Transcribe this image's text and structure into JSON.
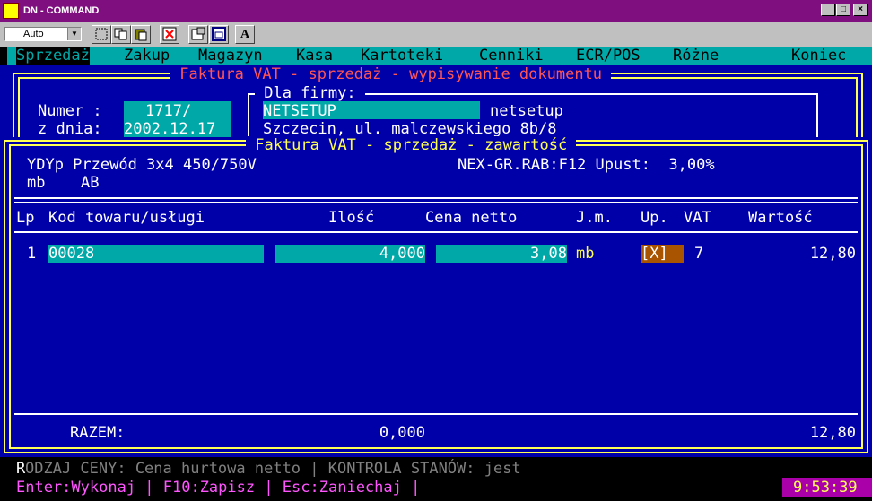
{
  "window": {
    "title": "DN - COMMAND",
    "minimize_glyph": "_",
    "maximize_glyph": "□",
    "close_glyph": "×"
  },
  "toolbar": {
    "font_size_value": "Auto",
    "font_glyph": "A"
  },
  "menu": {
    "items": [
      "Sprzedaż",
      "Zakup",
      "Magazyn",
      "Kasa",
      "Kartoteki",
      "Cenniki",
      "ECR/POS",
      "Różne",
      "Koniec"
    ]
  },
  "outer_panel": {
    "title": " Faktura VAT - sprzedaż - wypisywanie dokumentu ",
    "numer_label": "Numer :",
    "numer_value": "1717/",
    "date_label": "z dnia:",
    "date_value": "2002.12.17",
    "firm_label": " Dla firmy: ",
    "firm_code": "NETSETUP",
    "firm_name": "netsetup",
    "firm_address": "Szczecin, ul. malczewskiego 8b/8"
  },
  "inner_panel": {
    "title": " Faktura VAT - sprzedaż - zawartość ",
    "product_name": "YDYp Przewód 3x4 450/750V",
    "unit": "mb",
    "group": "AB",
    "discount_info": "NEX-GR.RAB:F12 Upust:  3,00%",
    "columns": {
      "lp": "Lp",
      "code": "Kod towaru/usługi",
      "qty": "Ilość",
      "price": "Cena netto",
      "unit": "J.m.",
      "up": "Up.",
      "vat": "VAT",
      "value": "Wartość"
    },
    "rows": [
      {
        "lp": "1",
        "code": "00028",
        "qty": "4,000",
        "price": "3,08",
        "unit": "mb",
        "up": "[X]",
        "vat": "7",
        "value": "12,80"
      }
    ],
    "total_label": "RAZEM:",
    "total_qty": "0,000",
    "total_value": "12,80"
  },
  "status": {
    "line1_first": "R",
    "line1_rest": "ODZAJ CENY: Cena hurtowa netto | KONTROLA STANÓW: jest",
    "line2": "Enter:Wykonaj | F10:Zapisz | Esc:Zaniechaj |",
    "clock": "9:53:39"
  },
  "colors": {
    "title_bar": "#7f0f7f",
    "console_blue": "#0000a8",
    "cyan_field": "#00a8a8",
    "frame_yellow": "#ffff55",
    "title_red": "#ff5555",
    "checkbox_orange": "#a85400",
    "clock_magenta": "#aa00aa"
  }
}
